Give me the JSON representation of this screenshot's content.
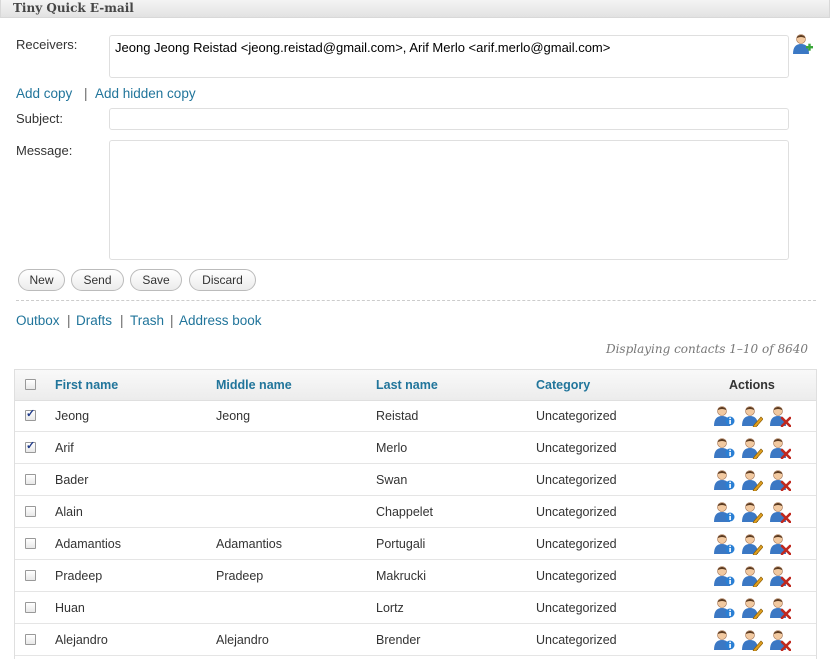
{
  "app": {
    "title": "Tiny Quick E-mail"
  },
  "compose": {
    "receivers_label": "Receivers:",
    "receivers_value": "Jeong Jeong Reistad <jeong.reistad@gmail.com>, Arif Merlo <arif.merlo@gmail.com>",
    "add_copy": "Add copy",
    "link_sep": "|",
    "add_hidden_copy": "Add hidden copy",
    "subject_label": "Subject:",
    "subject_value": "",
    "message_label": "Message:",
    "message_value": ""
  },
  "buttons": {
    "new": "New",
    "send": "Send",
    "save": "Save",
    "discard": "Discard"
  },
  "nav": {
    "outbox": "Outbox",
    "drafts": "Drafts",
    "trash": "Trash",
    "address_book": "Address book",
    "sep": "|"
  },
  "pager": {
    "text": "Displaying contacts 1–10 of 8640"
  },
  "table": {
    "headers": {
      "first": "First name",
      "middle": "Middle name",
      "last": "Last name",
      "category": "Category",
      "actions": "Actions"
    },
    "rows": [
      {
        "checked": true,
        "first": "Jeong",
        "middle": "Jeong",
        "last": "Reistad",
        "category": "Uncategorized"
      },
      {
        "checked": true,
        "first": "Arif",
        "middle": "",
        "last": "Merlo",
        "category": "Uncategorized"
      },
      {
        "checked": false,
        "first": "Bader",
        "middle": "",
        "last": "Swan",
        "category": "Uncategorized"
      },
      {
        "checked": false,
        "first": "Alain",
        "middle": "",
        "last": "Chappelet",
        "category": "Uncategorized"
      },
      {
        "checked": false,
        "first": "Adamantios",
        "middle": "Adamantios",
        "last": "Portugali",
        "category": "Uncategorized"
      },
      {
        "checked": false,
        "first": "Pradeep",
        "middle": "Pradeep",
        "last": "Makrucki",
        "category": "Uncategorized"
      },
      {
        "checked": false,
        "first": "Huan",
        "middle": "",
        "last": "Lortz",
        "category": "Uncategorized"
      },
      {
        "checked": false,
        "first": "Alejandro",
        "middle": "Alejandro",
        "last": "Brender",
        "category": "Uncategorized"
      }
    ],
    "action_icons": [
      "contact-info-icon",
      "contact-edit-icon",
      "contact-delete-icon"
    ]
  },
  "colors": {
    "link": "#21759b",
    "info": "#2a7fd4",
    "edit": "#e0a020",
    "delete": "#c0281e"
  }
}
